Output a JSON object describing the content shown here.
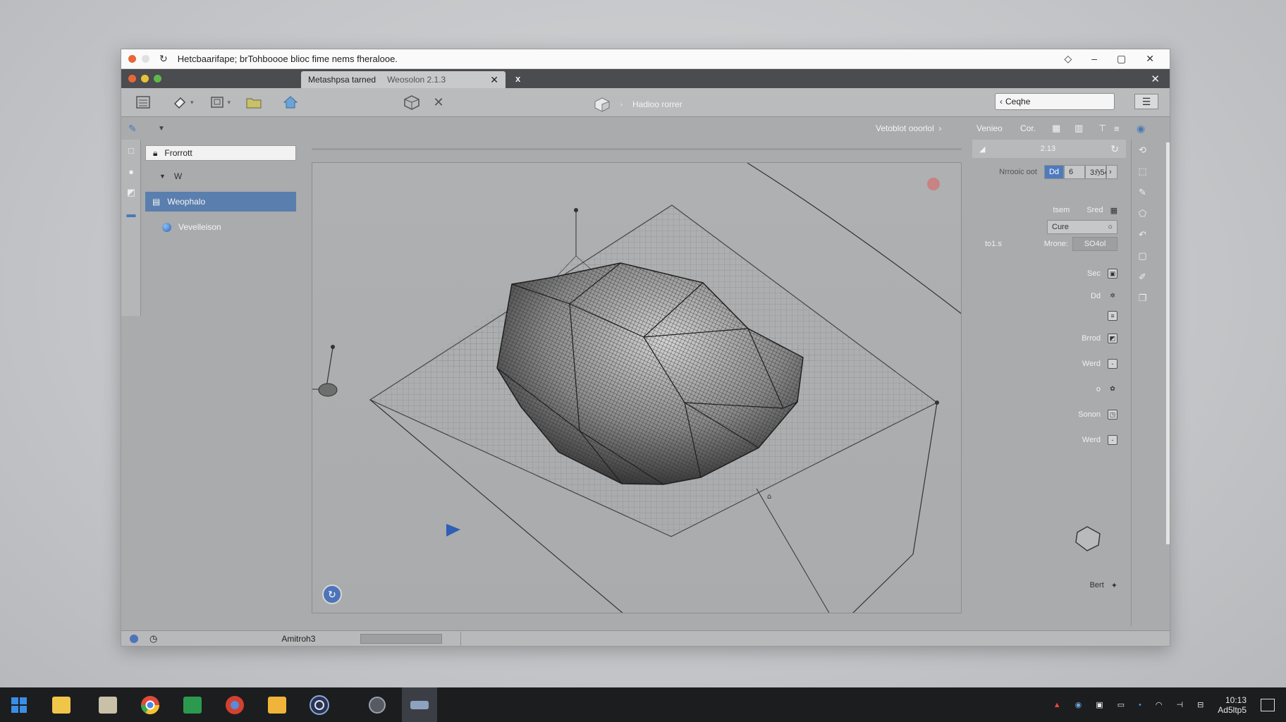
{
  "outer_window": {
    "title": "Hetcbaarifape; brTohboooe blioc fime nems fheralooe.",
    "controls": [
      "◇",
      "–",
      "▢",
      "✕"
    ]
  },
  "tab": {
    "label": "Metashpsa  tarned",
    "sub": "Weosolon 2.1.3",
    "close": "✕",
    "new": "x"
  },
  "toolbar": {
    "doc_label": "Hadioo rorrer",
    "search_value": "Ceqhe"
  },
  "subbar": {
    "breadcrumb": "Vetoblot ooorlol",
    "views": [
      "Venieo",
      "Cor."
    ]
  },
  "tree": {
    "search_value": "Frorrott",
    "group": "W",
    "selected": "Weophalo",
    "child": "Vevelleison"
  },
  "properties": {
    "header_value": "2.13",
    "row1_label": "Nrrooic oot",
    "row1_chip": "Dd",
    "row1_value": "6",
    "row1_value2": "3ℌ54",
    "row2_label": "tsem",
    "row2_label2": "Sred",
    "row3_value": "Cure",
    "row4_left": "to1.s",
    "row4_label": "Mrone:",
    "row4_value": "SO4ol",
    "labels": [
      "Sec",
      "Dd",
      "",
      "Brrod",
      "Werd",
      "o",
      "Sonon",
      "Werd"
    ],
    "bottom_label": "Bert"
  },
  "statusbar": {
    "label": "Amitroh3"
  },
  "taskbar": {
    "time": "10:13",
    "date": "Ad5ltp5"
  },
  "colors": {
    "accent": "#5a7eae",
    "close_dot": "#e9663b",
    "min_dot": "#e8c13a",
    "max_dot": "#5fb84a"
  }
}
